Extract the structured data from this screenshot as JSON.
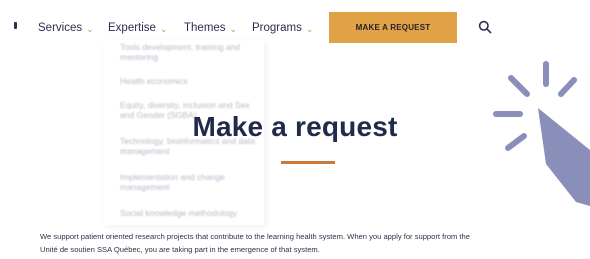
{
  "nav": {
    "items": [
      {
        "label": "Services",
        "chevron": "chevron-down-icon"
      },
      {
        "label": "Expertise",
        "chevron": "chevron-down-icon"
      },
      {
        "label": "Themes",
        "chevron": "chevron-down-icon"
      },
      {
        "label": "Programs",
        "chevron": "chevron-down-icon"
      }
    ],
    "cta_label": "MAKE A REQUEST",
    "search_icon": "search-icon"
  },
  "dropdown": {
    "items": [
      "Tools development, training and mentoring",
      "Health economics",
      "Equity, diversity, inclusion and Sex and Gender (SGBA)",
      "Technology, bioinformatics and data management",
      "Implementation and change management",
      "Social knowledge methodology"
    ]
  },
  "main": {
    "title": "Make a request",
    "intro_line1": "We support patient oriented research projects that contribute to the learning health system. When you apply for support from the",
    "intro_line2": "Unité de soutien SSA Québec, you are taking part in the emergence of that system."
  },
  "colors": {
    "accent": "#e0a244",
    "rule": "#c97a3a",
    "heading": "#202a4a",
    "graphic": "#8a8fba"
  }
}
